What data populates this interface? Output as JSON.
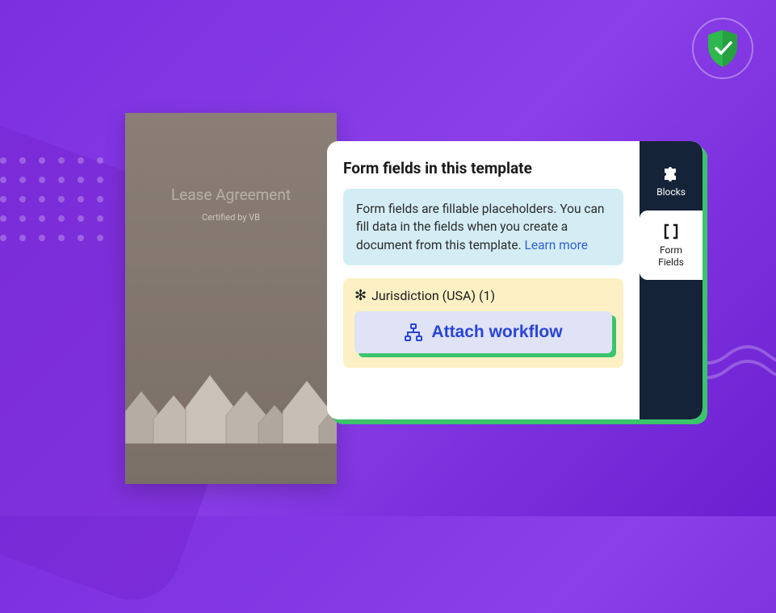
{
  "document": {
    "title": "Lease Agreement",
    "certified_by": "Certified by VB"
  },
  "panel": {
    "title": "Form fields in this template",
    "info_text": "Form fields are fillable placeholders. You can fill data in the fields when you create a document from this template. ",
    "learn_more": "Learn more",
    "field": {
      "label": "Jurisdiction (USA) (1)"
    },
    "attach_button": "Attach workflow"
  },
  "sidebar": {
    "blocks": "Blocks",
    "form_fields": "Form\nFields"
  }
}
